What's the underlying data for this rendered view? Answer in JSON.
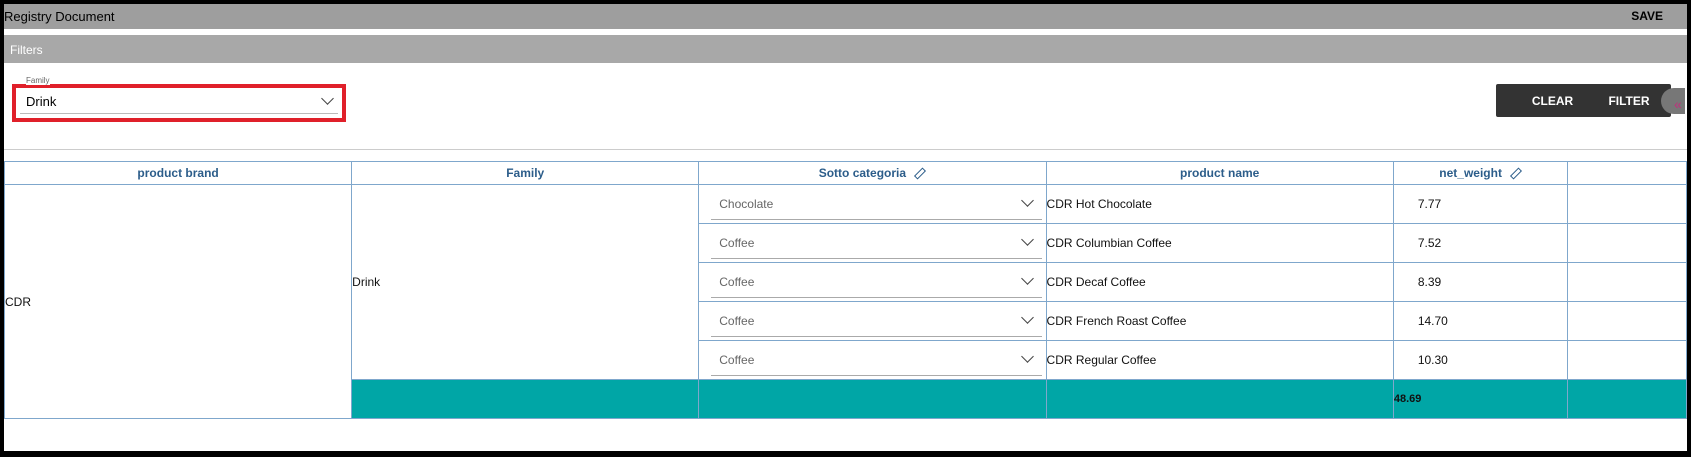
{
  "header": {
    "title": "Registry Document",
    "save_label": "SAVE"
  },
  "filters": {
    "title": "Filters",
    "family": {
      "label": "Family",
      "value": "Drink"
    },
    "clear_label": "CLEAR",
    "filter_label": "FILTER",
    "collapse_glyph": "«"
  },
  "table": {
    "columns": [
      "product brand",
      "Family",
      "Sotto categoria",
      "product name",
      "net_weight",
      ""
    ],
    "brand": "CDR",
    "family": "Drink",
    "rows": [
      {
        "sotto_categoria": "Chocolate",
        "product_name": "CDR Hot Chocolate",
        "net_weight": "7.77"
      },
      {
        "sotto_categoria": "Coffee",
        "product_name": "CDR Columbian Coffee",
        "net_weight": "7.52"
      },
      {
        "sotto_categoria": "Coffee",
        "product_name": "CDR Decaf Coffee",
        "net_weight": "8.39"
      },
      {
        "sotto_categoria": "Coffee",
        "product_name": "CDR French Roast Coffee",
        "net_weight": "14.70"
      },
      {
        "sotto_categoria": "Coffee",
        "product_name": "CDR Regular Coffee",
        "net_weight": "10.30"
      }
    ],
    "total_net_weight": "48.69"
  },
  "colors": {
    "accent": "#00a6a6",
    "highlight_border": "#e0202a",
    "header_text": "#2c5d8a"
  }
}
